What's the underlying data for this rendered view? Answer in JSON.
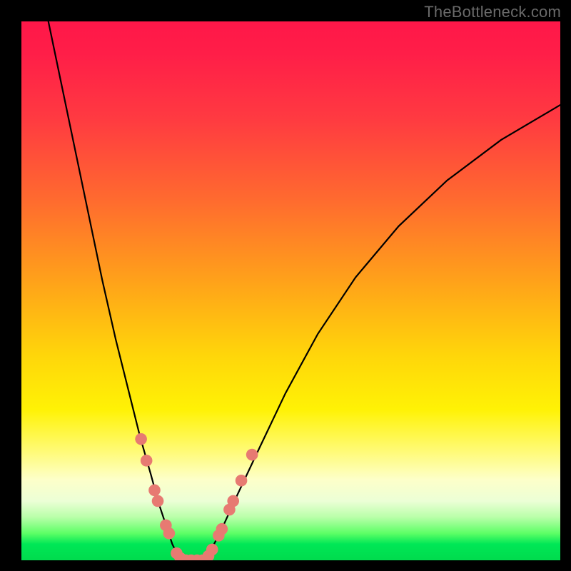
{
  "watermark": "TheBottleneck.com",
  "chart_data": {
    "type": "line",
    "title": "",
    "xlabel": "",
    "ylabel": "",
    "xlim": [
      0,
      100
    ],
    "ylim": [
      0,
      100
    ],
    "grid": false,
    "legend": false,
    "gradient_colors": {
      "top": "#ff1749",
      "mid_upper": "#ff6a2f",
      "mid": "#ffd60a",
      "mid_lower": "#fffb7a",
      "bottom": "#00db4d"
    },
    "series": [
      {
        "name": "left-branch",
        "x": [
          5.0,
          7.5,
          10.0,
          12.5,
          15.0,
          17.5,
          20.0,
          22.0,
          24.0,
          25.5,
          27.0,
          28.0,
          29.0,
          29.8
        ],
        "y": [
          100,
          88,
          76,
          64,
          52,
          41,
          31,
          23,
          16,
          10.5,
          6.0,
          3.0,
          1.0,
          0.0
        ]
      },
      {
        "name": "valley-floor",
        "x": [
          29.8,
          31.0,
          32.5,
          34.0
        ],
        "y": [
          0.0,
          0.0,
          0.0,
          0.0
        ]
      },
      {
        "name": "right-branch",
        "x": [
          34.0,
          35.5,
          37.5,
          40.0,
          44.0,
          49.0,
          55.0,
          62.0,
          70.0,
          79.0,
          89.0,
          100.0
        ],
        "y": [
          0.0,
          2.5,
          6.5,
          12.0,
          20.5,
          31.0,
          42.0,
          52.5,
          62.0,
          70.5,
          78.0,
          84.5
        ]
      }
    ],
    "markers": {
      "name": "highlighted-points",
      "color": "#e77a72",
      "radius_approx_pct": 1.1,
      "points": [
        {
          "x": 22.2,
          "y": 22.5
        },
        {
          "x": 23.2,
          "y": 18.5
        },
        {
          "x": 24.7,
          "y": 13.0
        },
        {
          "x": 25.3,
          "y": 11.0
        },
        {
          "x": 26.8,
          "y": 6.5
        },
        {
          "x": 27.4,
          "y": 5.0
        },
        {
          "x": 28.8,
          "y": 1.3
        },
        {
          "x": 29.5,
          "y": 0.4
        },
        {
          "x": 30.5,
          "y": 0.0
        },
        {
          "x": 31.5,
          "y": 0.0
        },
        {
          "x": 32.6,
          "y": 0.0
        },
        {
          "x": 33.6,
          "y": 0.0
        },
        {
          "x": 34.7,
          "y": 0.8
        },
        {
          "x": 35.4,
          "y": 2.0
        },
        {
          "x": 36.6,
          "y": 4.6
        },
        {
          "x": 37.2,
          "y": 5.8
        },
        {
          "x": 38.6,
          "y": 9.4
        },
        {
          "x": 39.3,
          "y": 11.0
        },
        {
          "x": 40.8,
          "y": 14.8
        },
        {
          "x": 42.8,
          "y": 19.6
        }
      ]
    }
  }
}
